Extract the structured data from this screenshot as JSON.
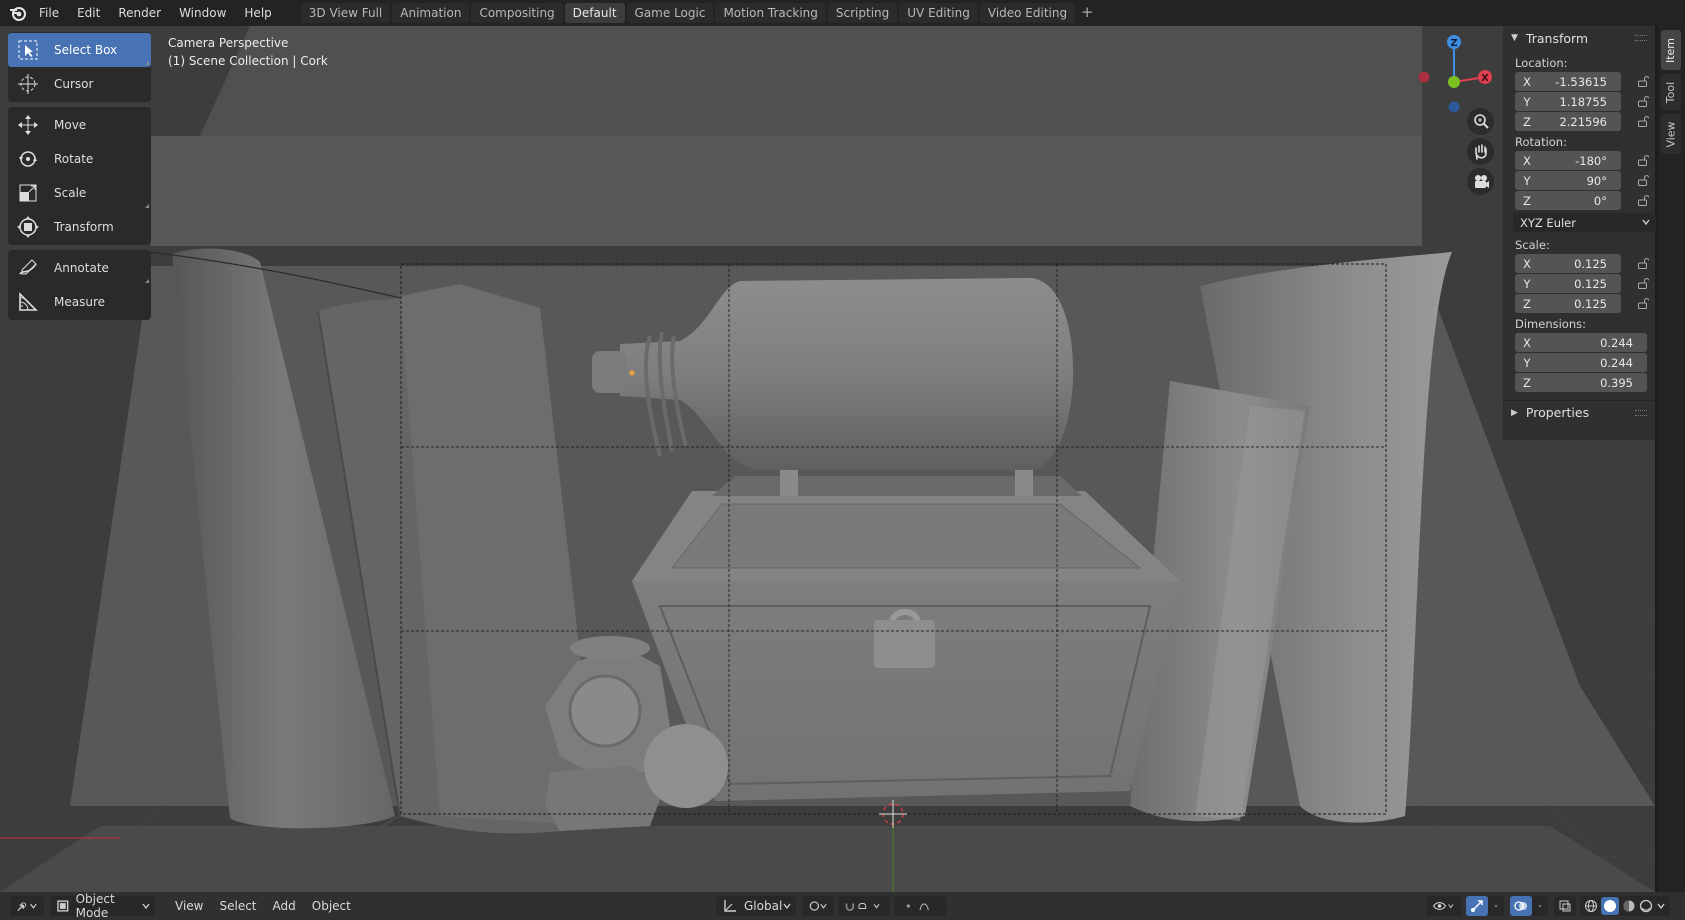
{
  "menu": [
    "File",
    "Edit",
    "Render",
    "Window",
    "Help"
  ],
  "workspaces": [
    {
      "label": "3D View Full",
      "active": false
    },
    {
      "label": "Animation",
      "active": false
    },
    {
      "label": "Compositing",
      "active": false
    },
    {
      "label": "Default",
      "active": true
    },
    {
      "label": "Game Logic",
      "active": false
    },
    {
      "label": "Motion Tracking",
      "active": false
    },
    {
      "label": "Scripting",
      "active": false
    },
    {
      "label": "UV Editing",
      "active": false
    },
    {
      "label": "Video Editing",
      "active": false
    }
  ],
  "workspace_add_icon": "plus-icon",
  "viewport": {
    "mode_label": "Camera Perspective",
    "collection_label": "(1) Scene Collection | Cork"
  },
  "tools": {
    "select_box": "Select Box",
    "cursor": "Cursor",
    "move": "Move",
    "rotate": "Rotate",
    "scale": "Scale",
    "transform": "Transform",
    "annotate": "Annotate",
    "measure": "Measure"
  },
  "gizmo": {
    "z": "Z",
    "x": "X"
  },
  "transform_panel": {
    "title": "Transform",
    "location_label": "Location:",
    "location": {
      "x": "-1.53615",
      "y": "1.18755",
      "z": "2.21596"
    },
    "rotation_label": "Rotation:",
    "rotation": {
      "x": "-180°",
      "y": "90°",
      "z": "0°"
    },
    "rotation_mode": "XYZ Euler",
    "scale_label": "Scale:",
    "scale": {
      "x": "0.125",
      "y": "0.125",
      "z": "0.125"
    },
    "dimensions_label": "Dimensions:",
    "dimensions": {
      "x": "0.244",
      "y": "0.244",
      "z": "0.395"
    },
    "axis": {
      "x": "X",
      "y": "Y",
      "z": "Z"
    }
  },
  "properties_panel": {
    "title": "Properties"
  },
  "side_tabs": [
    "Item",
    "Tool",
    "View"
  ],
  "bottom": {
    "mode": "Object Mode",
    "menus": [
      "View",
      "Select",
      "Add",
      "Object"
    ],
    "orientation": "Global"
  },
  "colors": {
    "accent": "#4772b3",
    "axis_x": "#e04050",
    "axis_y": "#7dc023",
    "axis_z": "#3d8fe0"
  }
}
